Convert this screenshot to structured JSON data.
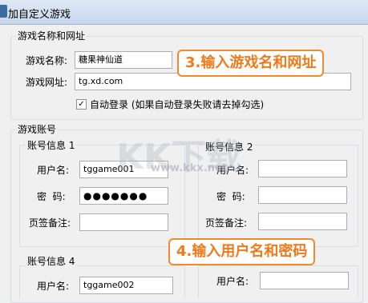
{
  "window": {
    "title": "加自定义游戏"
  },
  "game_info": {
    "group_label": "游戏名称和网址",
    "name_label": "游戏名称:",
    "name_value": "糖果神仙道",
    "url_label": "游戏网址:",
    "url_value": "tg.xd.com",
    "autologin_checked": true,
    "autologin_mark": "✓",
    "autologin_label": "自动登录 (如果自动登录失败请去掉勾选)"
  },
  "accounts": {
    "group_label": "游戏账号",
    "account1": {
      "label": "账号信息 1",
      "username_label": "用户名:",
      "username_value": "tggame001",
      "password_label": "密  码:",
      "password_value": "●●●●●●●",
      "note_label": "页签备注:",
      "note_value": ""
    },
    "account2": {
      "label": "账号信息 2",
      "username_label": "用户名:",
      "username_value": "",
      "password_label": "密  码:",
      "password_value": "",
      "note_label": "页签备注:",
      "note_value": ""
    },
    "account4": {
      "label": "账号信息 4",
      "username_label": "用户名:",
      "username_value": "tggame002"
    },
    "account5": {
      "username_label": "用户名:",
      "username_value": ""
    }
  },
  "annotations": {
    "step3": "3.输入游戏名和网址",
    "step4": "4.输入用户名和密码"
  },
  "watermark": {
    "logo": "KK下载",
    "url": "www.kkx.net"
  },
  "colors": {
    "callout_text": "#f07a1a",
    "callout_border": "#f08a2a",
    "titlebar": "#c7d7ec"
  }
}
